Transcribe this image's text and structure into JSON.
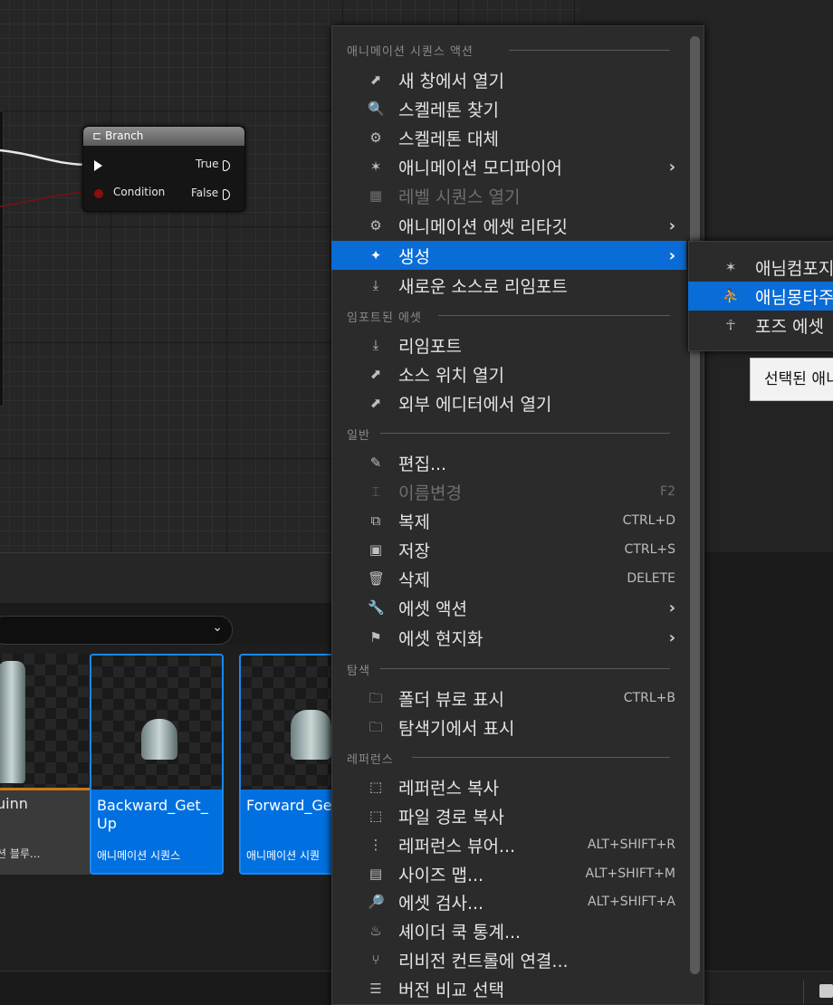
{
  "graph": {
    "branch": {
      "title": "Branch",
      "pin_condition": "Condition",
      "pin_true": "True",
      "pin_false": "False"
    }
  },
  "content_browser": {
    "tiles": [
      {
        "name": "uinn",
        "type": "션 블루..."
      },
      {
        "name": "Backward_Get_\nUp",
        "type": "애니메이션 시퀀스"
      },
      {
        "name": "Forward_Ge",
        "type": "애니메이션 시퀀"
      }
    ]
  },
  "menu": {
    "sections": [
      "애니메이션 시퀀스 액션",
      "임포트된 에셋",
      "일반",
      "탐색",
      "레퍼런스"
    ],
    "items": [
      {
        "label": "새 창에서 열기",
        "icon": "open-window-icon"
      },
      {
        "label": "스켈레톤 찾기",
        "icon": "find-skeleton-icon"
      },
      {
        "label": "스켈레톤 대체",
        "icon": "replace-skeleton-icon"
      },
      {
        "label": "애니메이션 모디파이어",
        "icon": "animation-modifier-icon",
        "submenu": true
      },
      {
        "label": "레벨 시퀀스 열기",
        "icon": "level-sequence-icon",
        "disabled": true
      },
      {
        "label": "애니메이션 에셋 리타깃",
        "icon": "retarget-icon",
        "submenu": true
      },
      {
        "label": "생성",
        "icon": "create-icon",
        "submenu": true,
        "highlighted": true
      },
      {
        "label": "새로운 소스로 리임포트",
        "icon": "reimport-new-source-icon"
      },
      {
        "label": "리임포트",
        "icon": "reimport-icon"
      },
      {
        "label": "소스 위치 열기",
        "icon": "open-source-location-icon"
      },
      {
        "label": "외부 에디터에서 열기",
        "icon": "open-external-editor-icon"
      },
      {
        "label": "편집...",
        "icon": "edit-icon"
      },
      {
        "label": "이름변경",
        "icon": "rename-icon",
        "shortcut": "F2",
        "disabled": true
      },
      {
        "label": "복제",
        "icon": "duplicate-icon",
        "shortcut": "CTRL+D"
      },
      {
        "label": "저장",
        "icon": "save-icon",
        "shortcut": "CTRL+S"
      },
      {
        "label": "삭제",
        "icon": "delete-icon",
        "shortcut": "DELETE"
      },
      {
        "label": "에셋 액션",
        "icon": "wrench-icon",
        "submenu": true
      },
      {
        "label": "에셋 현지화",
        "icon": "flag-icon",
        "submenu": true
      },
      {
        "label": "폴더 뷰로 표시",
        "icon": "folder-view-icon",
        "shortcut": "CTRL+B"
      },
      {
        "label": "탐색기에서 표시",
        "icon": "show-in-explorer-icon"
      },
      {
        "label": "레퍼런스 복사",
        "icon": "copy-reference-icon"
      },
      {
        "label": "파일 경로 복사",
        "icon": "copy-file-path-icon"
      },
      {
        "label": "레퍼런스 뷰어...",
        "icon": "reference-viewer-icon",
        "shortcut": "ALT+SHIFT+R"
      },
      {
        "label": "사이즈 맵...",
        "icon": "size-map-icon",
        "shortcut": "ALT+SHIFT+M"
      },
      {
        "label": "에셋 검사...",
        "icon": "audit-asset-icon",
        "shortcut": "ALT+SHIFT+A"
      },
      {
        "label": "셰이더 쿡 통계...",
        "icon": "shader-cook-icon"
      },
      {
        "label": "리비전 컨트롤에 연결...",
        "icon": "revision-control-icon"
      },
      {
        "label": "버전 비교 선택",
        "icon": "diff-icon"
      }
    ]
  },
  "submenu": {
    "items": [
      {
        "label": "애님컴포지",
        "icon": "anim-composite-icon"
      },
      {
        "label": "애님몽타주",
        "icon": "anim-montage-icon",
        "highlighted": true
      },
      {
        "label": "포즈 에셋",
        "icon": "pose-asset-icon"
      }
    ],
    "tooltip": "선택된 애니"
  }
}
